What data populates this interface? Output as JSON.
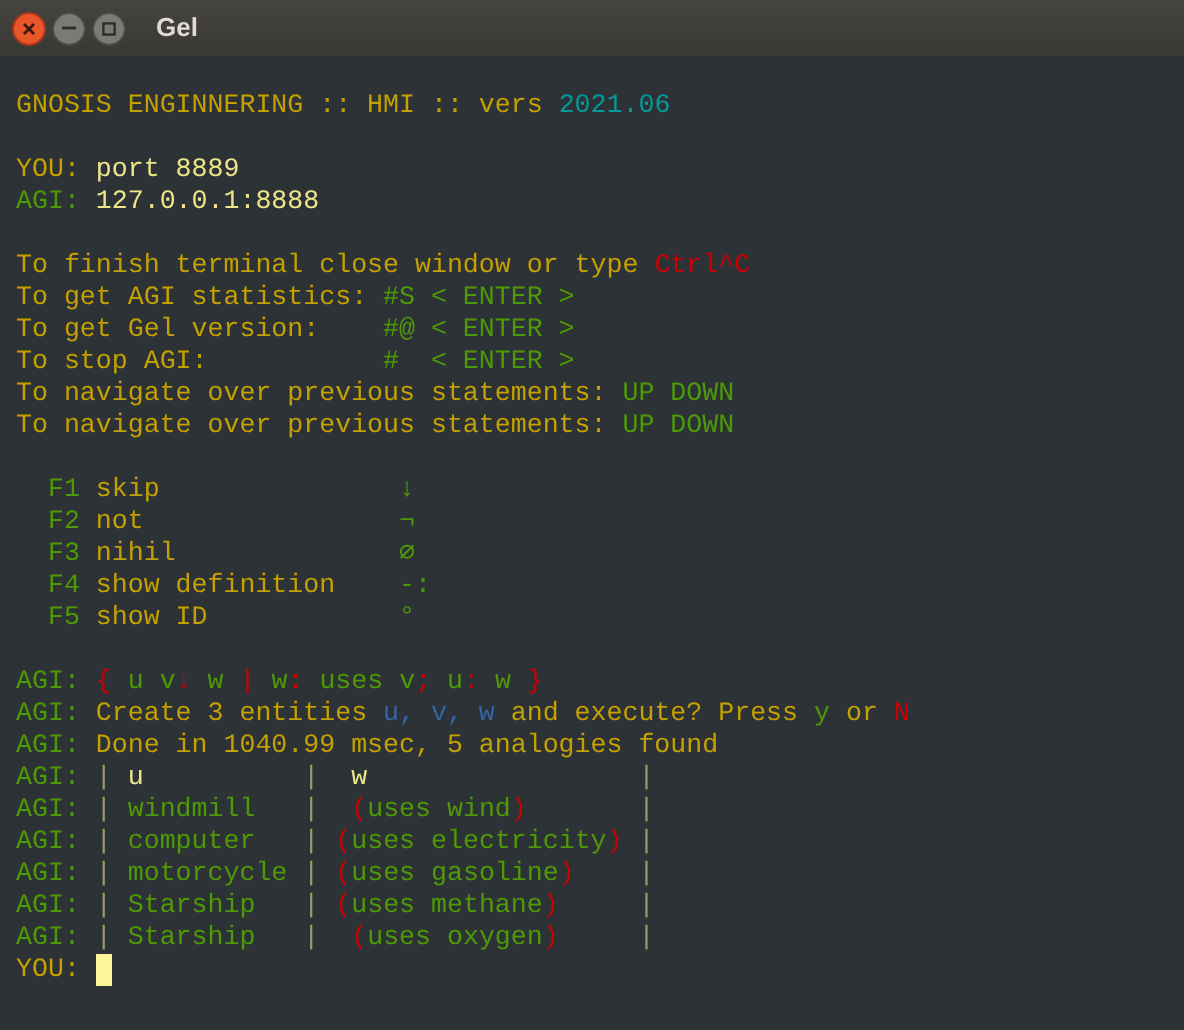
{
  "window": {
    "title": "Gel"
  },
  "terminal": {
    "blocks": [
      {
        "lines": [
          {
            "segments": [
              {
                "kind": "accent",
                "text": "GNOSIS ENGINNERING :: HMI :: vers "
              },
              {
                "kind": "version",
                "text": "2021.06"
              }
            ]
          }
        ]
      },
      {
        "lines": [
          {
            "segments": [
              {
                "kind": "accent",
                "text": "YOU: "
              },
              {
                "kind": "value",
                "text": "port 8889"
              }
            ]
          },
          {
            "segments": [
              {
                "kind": "agi",
                "text": "AGI: "
              },
              {
                "kind": "value",
                "text": "127.0.0.1:8888"
              }
            ]
          }
        ]
      },
      {
        "lines": [
          {
            "segments": [
              {
                "kind": "accent",
                "text": "To finish terminal close window or type "
              },
              {
                "kind": "alert",
                "text": "Ctrl^C"
              }
            ]
          },
          {
            "segments": [
              {
                "kind": "accent",
                "text": "To get AGI statistics: "
              },
              {
                "kind": "agi",
                "text": "#S < ENTER >"
              }
            ]
          },
          {
            "segments": [
              {
                "kind": "accent",
                "text": "To get Gel version:    "
              },
              {
                "kind": "agi",
                "text": "#@ < ENTER >"
              }
            ]
          },
          {
            "segments": [
              {
                "kind": "accent",
                "text": "To stop AGI:           "
              },
              {
                "kind": "agi",
                "text": "#  < ENTER >"
              }
            ]
          },
          {
            "segments": [
              {
                "kind": "accent",
                "text": "To navigate over previous statements: "
              },
              {
                "kind": "agi",
                "text": "UP DOWN"
              }
            ]
          },
          {
            "segments": [
              {
                "kind": "accent",
                "text": "To navigate over previous statements: "
              },
              {
                "kind": "agi",
                "text": "UP DOWN"
              }
            ]
          }
        ]
      },
      {
        "lines": [
          {
            "segments": [
              {
                "kind": "agi",
                "text": "  F1 "
              },
              {
                "kind": "accent",
                "text": "skip               "
              },
              {
                "kind": "agi",
                "text": "↓"
              }
            ]
          },
          {
            "segments": [
              {
                "kind": "agi",
                "text": "  F2 "
              },
              {
                "kind": "accent",
                "text": "not                "
              },
              {
                "kind": "agi",
                "text": "¬"
              }
            ]
          },
          {
            "segments": [
              {
                "kind": "agi",
                "text": "  F3 "
              },
              {
                "kind": "accent",
                "text": "nihil              "
              },
              {
                "kind": "agi",
                "text": "∅"
              }
            ]
          },
          {
            "segments": [
              {
                "kind": "agi",
                "text": "  F4 "
              },
              {
                "kind": "accent",
                "text": "show definition    "
              },
              {
                "kind": "agi",
                "text": "-:"
              }
            ]
          },
          {
            "segments": [
              {
                "kind": "agi",
                "text": "  F5 "
              },
              {
                "kind": "accent",
                "text": "show ID            "
              },
              {
                "kind": "agi",
                "text": "°"
              }
            ]
          }
        ]
      },
      {
        "lines": [
          {
            "segments": [
              {
                "kind": "agi",
                "text": "AGI: "
              },
              {
                "kind": "alert",
                "text": "{ "
              },
              {
                "kind": "agi",
                "text": "u v"
              },
              {
                "kind": "alert",
                "text": "↓ "
              },
              {
                "kind": "agi",
                "text": "w "
              },
              {
                "kind": "alert",
                "text": "| "
              },
              {
                "kind": "agi",
                "text": "w"
              },
              {
                "kind": "alert",
                "text": ": "
              },
              {
                "kind": "agi",
                "text": "uses v"
              },
              {
                "kind": "alert",
                "text": "; "
              },
              {
                "kind": "agi",
                "text": "u"
              },
              {
                "kind": "alert",
                "text": ": "
              },
              {
                "kind": "agi",
                "text": "w "
              },
              {
                "kind": "alert",
                "text": "}"
              }
            ]
          },
          {
            "segments": [
              {
                "kind": "agi",
                "text": "AGI: "
              },
              {
                "kind": "accent",
                "text": "Create 3 entities "
              },
              {
                "kind": "entity",
                "text": "u, v, w"
              },
              {
                "kind": "accent",
                "text": " and execute? Press "
              },
              {
                "kind": "agi",
                "text": "y"
              },
              {
                "kind": "accent",
                "text": " or "
              },
              {
                "kind": "alert",
                "text": "N"
              }
            ]
          },
          {
            "segments": [
              {
                "kind": "agi",
                "text": "AGI: "
              },
              {
                "kind": "accent",
                "text": "Done in 1040.99 msec, 5 analogies found"
              }
            ]
          },
          {
            "segments": [
              {
                "kind": "agi",
                "text": "AGI: "
              },
              {
                "kind": "border",
                "text": "|"
              },
              {
                "kind": "value",
                "text": " u          "
              },
              {
                "kind": "border",
                "text": "|"
              },
              {
                "kind": "value",
                "text": "  w                 "
              },
              {
                "kind": "border",
                "text": "|"
              }
            ]
          },
          {
            "segments": [
              {
                "kind": "agi",
                "text": "AGI: "
              },
              {
                "kind": "border",
                "text": "|"
              },
              {
                "kind": "agi",
                "text": " windmill   "
              },
              {
                "kind": "border",
                "text": "|"
              },
              {
                "kind": "alert",
                "text": "  ("
              },
              {
                "kind": "agi",
                "text": "uses wind"
              },
              {
                "kind": "alert",
                "text": ")       "
              },
              {
                "kind": "border",
                "text": "|"
              }
            ]
          },
          {
            "segments": [
              {
                "kind": "agi",
                "text": "AGI: "
              },
              {
                "kind": "border",
                "text": "|"
              },
              {
                "kind": "agi",
                "text": " computer   "
              },
              {
                "kind": "border",
                "text": "|"
              },
              {
                "kind": "alert",
                "text": " ("
              },
              {
                "kind": "agi",
                "text": "uses electricity"
              },
              {
                "kind": "alert",
                "text": ") "
              },
              {
                "kind": "border",
                "text": "|"
              }
            ]
          },
          {
            "segments": [
              {
                "kind": "agi",
                "text": "AGI: "
              },
              {
                "kind": "border",
                "text": "|"
              },
              {
                "kind": "agi",
                "text": " motorcycle "
              },
              {
                "kind": "border",
                "text": "|"
              },
              {
                "kind": "alert",
                "text": " ("
              },
              {
                "kind": "agi",
                "text": "uses gasoline"
              },
              {
                "kind": "alert",
                "text": ")    "
              },
              {
                "kind": "border",
                "text": "|"
              }
            ]
          },
          {
            "segments": [
              {
                "kind": "agi",
                "text": "AGI: "
              },
              {
                "kind": "border",
                "text": "|"
              },
              {
                "kind": "agi",
                "text": " Starship   "
              },
              {
                "kind": "border",
                "text": "|"
              },
              {
                "kind": "alert",
                "text": " ("
              },
              {
                "kind": "agi",
                "text": "uses methane"
              },
              {
                "kind": "alert",
                "text": ")     "
              },
              {
                "kind": "border",
                "text": "|"
              }
            ]
          },
          {
            "segments": [
              {
                "kind": "agi",
                "text": "AGI: "
              },
              {
                "kind": "border",
                "text": "|"
              },
              {
                "kind": "agi",
                "text": " Starship   "
              },
              {
                "kind": "border",
                "text": "|"
              },
              {
                "kind": "alert",
                "text": "  ("
              },
              {
                "kind": "agi",
                "text": "uses oxygen"
              },
              {
                "kind": "alert",
                "text": ")     "
              },
              {
                "kind": "border",
                "text": "|"
              }
            ]
          }
        ]
      }
    ],
    "prompt": {
      "label": "YOU:",
      "cursor": true
    }
  }
}
